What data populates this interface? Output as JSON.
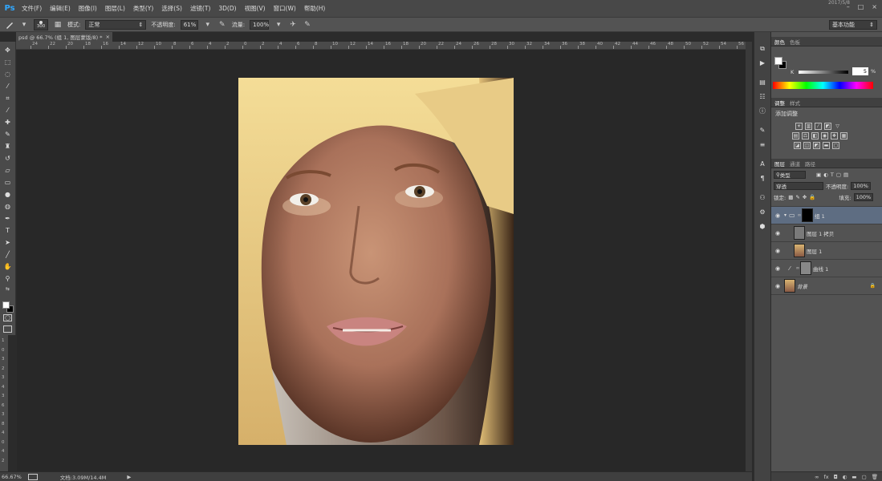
{
  "app": {
    "logo": "Ps",
    "year_readout": "2017/5/8"
  },
  "menu": [
    "文件(F)",
    "编辑(E)",
    "图像(I)",
    "图层(L)",
    "类型(Y)",
    "选择(S)",
    "滤镜(T)",
    "3D(D)",
    "视图(V)",
    "窗口(W)",
    "帮助(H)"
  ],
  "window_controls": {
    "minimize": "–",
    "maximize": "□",
    "close": "×"
  },
  "options": {
    "brush_size": "300",
    "mode_label": "模式:",
    "mode_value": "正常",
    "opacity_label": "不透明度:",
    "opacity_value": "61%",
    "flow_label": "流量:",
    "flow_value": "100%",
    "workspace": "基本功能"
  },
  "document": {
    "tab_title": "psd @ 66.7% (组 1, 图层蒙版/8) *",
    "close": "×"
  },
  "ruler_labels": [
    "24",
    "22",
    "20",
    "18",
    "16",
    "14",
    "12",
    "10",
    "8",
    "6",
    "4",
    "2",
    "0",
    "2",
    "4",
    "6",
    "8",
    "10",
    "12",
    "14",
    "16",
    "18",
    "20",
    "22",
    "24",
    "26",
    "28",
    "30",
    "32",
    "34",
    "36",
    "38",
    "40",
    "42",
    "44",
    "46",
    "48",
    "50",
    "52",
    "54",
    "56"
  ],
  "vruler_labels": [
    "1",
    "0",
    "3",
    "2",
    "3",
    "4",
    "3",
    "6",
    "3",
    "8",
    "4",
    "0",
    "4",
    "2"
  ],
  "status": {
    "zoom": "66.67%",
    "doc_label": "文档:3.09M/14.4M"
  },
  "colors": {
    "accent": "#31a8ff",
    "selected_layer": "#5e6d82",
    "panel_bg": "#535353",
    "canvas_bg": "#282828"
  },
  "color_panel": {
    "tabs": [
      "颜色",
      "色板"
    ],
    "k_label": "K",
    "k_value": "5",
    "k_unit": "%"
  },
  "adjustments_panel": {
    "tabs": [
      "调整",
      "样式"
    ],
    "title": "添加调整"
  },
  "layers_panel": {
    "tabs": [
      "图层",
      "通道",
      "路径"
    ],
    "filter_kind": "类型",
    "blend_mode": "穿透",
    "opacity_label": "不透明度:",
    "opacity_value": "100%",
    "lock_label": "锁定:",
    "fill_label": "填充:",
    "fill_value": "100%",
    "layers": [
      {
        "name": "组 1"
      },
      {
        "name": "图层 1 拷贝"
      },
      {
        "name": "图层 1"
      },
      {
        "name": "曲线 1"
      },
      {
        "name": "背景"
      }
    ],
    "footer": [
      "∞",
      "fx",
      "◘",
      "◐",
      "▬",
      "▢",
      "🗑"
    ]
  }
}
